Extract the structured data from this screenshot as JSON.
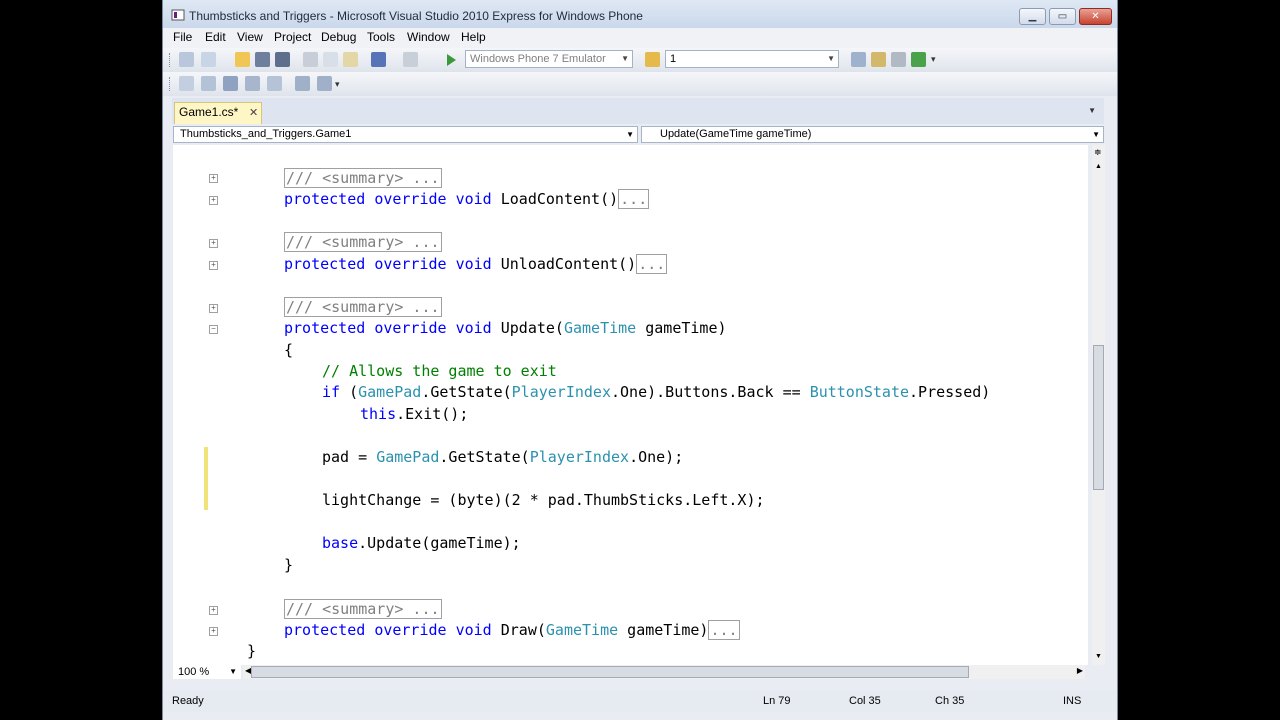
{
  "window": {
    "title": "Thumbsticks and Triggers - Microsoft Visual Studio 2010 Express for Windows Phone"
  },
  "menu": [
    "File",
    "Edit",
    "View",
    "Project",
    "Debug",
    "Tools",
    "Window",
    "Help"
  ],
  "toolbar": {
    "target": "Windows Phone 7 Emulator",
    "find_value": "1"
  },
  "tab": {
    "label": "Game1.cs*"
  },
  "nav": {
    "class_value": "Thumbsticks_and_Triggers.Game1",
    "member_value": "Update(GameTime gameTime)"
  },
  "code": {
    "summary": "/// <summary> ...",
    "ellipsis": "...",
    "protected": "protected",
    "override": "override",
    "void": "void",
    "loadcontent": "LoadContent()",
    "unloadcontent": "UnloadContent()",
    "update": "Update(",
    "gametime_type": "GameTime",
    "gametime_param": " gameTime)",
    "open_brace": "{",
    "close_brace": "}",
    "comment": "// Allows the game to exit",
    "if": "if",
    "gamepad": "GamePad",
    "getstate": ".GetState(",
    "playerindex": "PlayerIndex",
    "one": ".One)",
    "buttons_back": ".Buttons.Back == ",
    "buttonstate": "ButtonState",
    "pressed": ".Pressed)",
    "this": "this",
    "exit": ".Exit();",
    "pad_assign": "pad = ",
    "one_semicolon": ".One);",
    "lightchange": "lightChange = (byte)(2 * pad.ThumbSticks.Left.X);",
    "base": "base",
    "base_update": ".Update(gameTime);",
    "draw": "Draw(",
    "draw_param": " gameTime)"
  },
  "zoom": "100 %",
  "status": {
    "ready": "Ready",
    "ln": "Ln 79",
    "col": "Col 35",
    "ch": "Ch 35",
    "ins": "INS"
  }
}
